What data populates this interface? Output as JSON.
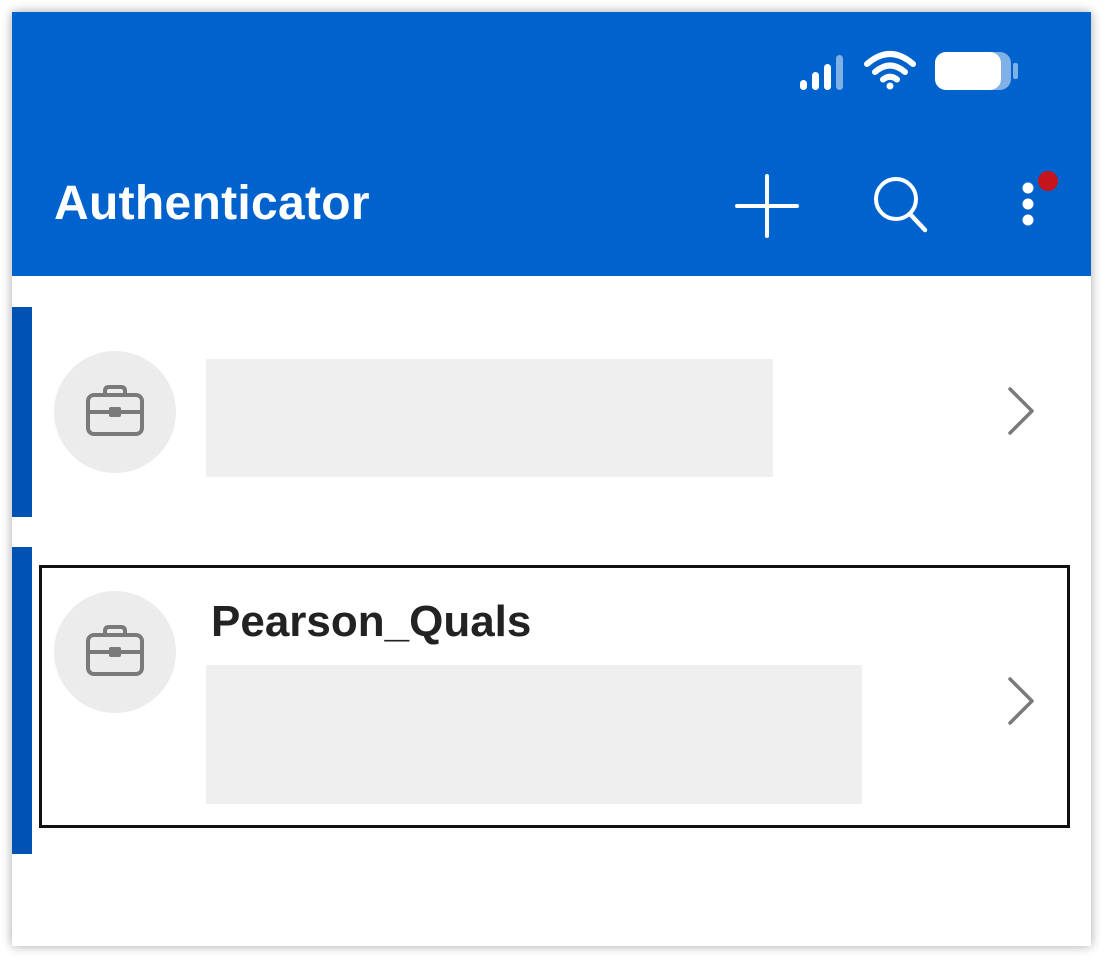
{
  "app": {
    "title": "Authenticator",
    "brand_color": "#0062cc",
    "notification_dot_color": "#c4151c"
  },
  "status_bar": {
    "icons": [
      "signal-icon",
      "wifi-icon",
      "battery-icon"
    ]
  },
  "toolbar": {
    "actions": [
      "add-icon",
      "search-icon",
      "more-options-icon"
    ]
  },
  "accounts": [
    {
      "name": "",
      "icon": "briefcase-icon",
      "details_redacted": true
    },
    {
      "name": "Pearson_Quals",
      "icon": "briefcase-icon",
      "details_redacted": true,
      "highlighted": true
    }
  ]
}
